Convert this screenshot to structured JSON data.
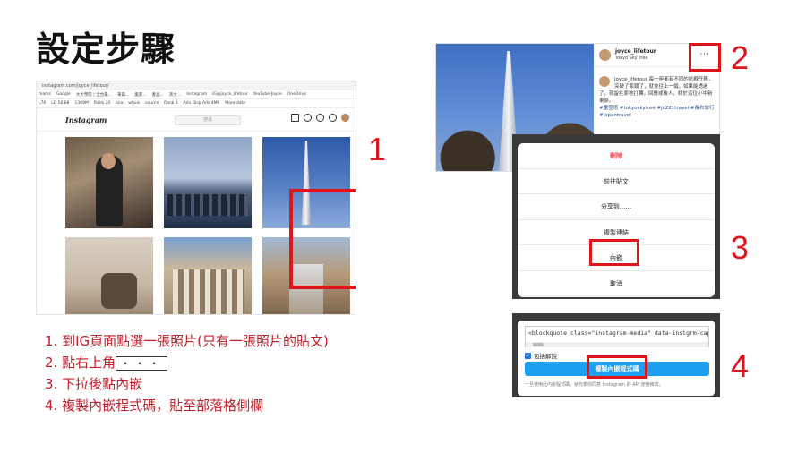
{
  "title": "設定步驟",
  "browser": {
    "url": "instagram.com/joyce_lifetour/",
    "bookmarks": [
      "marks",
      "Google",
      "大大學院 | 全台最...",
      "東森...",
      "奧萊...",
      "產品...",
      "英文...",
      "Instagram",
      "IG@joyce_lifetour",
      "YouTube-Joyce",
      "OneDrive"
    ],
    "bookmarks2": [
      "L76",
      "LD 56.88",
      "1369M",
      "Rank 20",
      "Ivia",
      "whois",
      "source",
      "Rank 0",
      "Adv Disp Ads 4MK",
      "More data"
    ],
    "logo": "Instagram",
    "search_placeholder": "搜尋"
  },
  "steps": [
    "1. 到IG頁面點選一張照片(只有一張照片的貼文)",
    "2. 點右上角",
    "3. 下拉後點內嵌",
    "4. 複製內嵌程式碼，貼至部落格側欄"
  ],
  "step2_dots": "・・・",
  "numbers": [
    "1",
    "2",
    "3",
    "4"
  ],
  "post": {
    "username": "joyce_lifetour",
    "location": "Tokyo Sky Tree",
    "more": "···",
    "caption": "joyce_lifetour 每一座都有不同的抗戰任務，突破了瓶頸了，就會往上一個，如果能透過了，就留在原地打轉，回應或後人，終於這位小中新東原。",
    "tags": "#璽亞塔 #tokyoskytree #jc221travel #長布旅行 #japantravel"
  },
  "menu": {
    "items": [
      "刪除",
      "前往貼文",
      "分享到......",
      "複製連結",
      "內嵌",
      "取消"
    ]
  },
  "embed": {
    "code": "<blockquote class=\"instagram-media\" data-instgrm-captio",
    "caption_label": "包括解說",
    "copy_button": "複製內嵌程式碼",
    "terms": "一旦使用此內嵌程式碼，就代表你同意 Instagram 的 API 使用條款。"
  },
  "colors": {
    "accent_red": "#e0141b",
    "step_text": "#c0202a",
    "ig_blue": "#1da0f2"
  }
}
